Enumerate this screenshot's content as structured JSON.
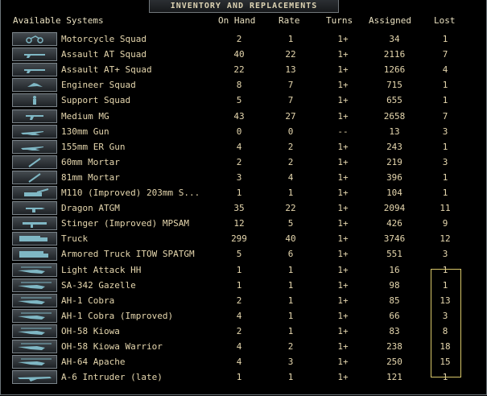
{
  "window": {
    "title": "INVENTORY AND REPLACEMENTS"
  },
  "columns": {
    "name": "Available Systems",
    "on_hand": "On Hand",
    "rate": "Rate",
    "turns": "Turns",
    "assigned": "Assigned",
    "lost": "Lost"
  },
  "rows": [
    {
      "name": "Motorcycle Squad",
      "on_hand": "2",
      "rate": "1",
      "turns": "1+",
      "assigned": "34",
      "lost": "1",
      "icon": "motorcycle-icon"
    },
    {
      "name": "Assault AT Squad",
      "on_hand": "40",
      "rate": "22",
      "turns": "1+",
      "assigned": "2116",
      "lost": "7",
      "icon": "rifle-icon"
    },
    {
      "name": "Assault AT+ Squad",
      "on_hand": "22",
      "rate": "13",
      "turns": "1+",
      "assigned": "1266",
      "lost": "4",
      "icon": "rifle-icon"
    },
    {
      "name": "Engineer Squad",
      "on_hand": "8",
      "rate": "7",
      "turns": "1+",
      "assigned": "715",
      "lost": "1",
      "icon": "engineer-icon"
    },
    {
      "name": "Support Squad",
      "on_hand": "5",
      "rate": "7",
      "turns": "1+",
      "assigned": "655",
      "lost": "1",
      "icon": "soldier-icon"
    },
    {
      "name": "Medium MG",
      "on_hand": "43",
      "rate": "27",
      "turns": "1+",
      "assigned": "2658",
      "lost": "7",
      "icon": "machine-gun-icon"
    },
    {
      "name": "130mm Gun",
      "on_hand": "0",
      "rate": "0",
      "turns": "--",
      "assigned": "13",
      "lost": "3",
      "icon": "artillery-gun-icon"
    },
    {
      "name": "155mm ER Gun",
      "on_hand": "4",
      "rate": "2",
      "turns": "1+",
      "assigned": "243",
      "lost": "1",
      "icon": "artillery-gun-icon"
    },
    {
      "name": "60mm Mortar",
      "on_hand": "2",
      "rate": "2",
      "turns": "1+",
      "assigned": "219",
      "lost": "3",
      "icon": "mortar-icon"
    },
    {
      "name": "81mm Mortar",
      "on_hand": "3",
      "rate": "4",
      "turns": "1+",
      "assigned": "396",
      "lost": "1",
      "icon": "mortar-icon"
    },
    {
      "name": "M110 (Improved) 203mm S...",
      "on_hand": "1",
      "rate": "1",
      "turns": "1+",
      "assigned": "104",
      "lost": "1",
      "icon": "self-propelled-gun-icon"
    },
    {
      "name": "Dragon ATGM",
      "on_hand": "35",
      "rate": "22",
      "turns": "1+",
      "assigned": "2094",
      "lost": "11",
      "icon": "atgm-icon"
    },
    {
      "name": "Stinger (Improved) MPSAM",
      "on_hand": "12",
      "rate": "5",
      "turns": "1+",
      "assigned": "426",
      "lost": "9",
      "icon": "missile-launcher-icon"
    },
    {
      "name": "Truck",
      "on_hand": "299",
      "rate": "40",
      "turns": "1+",
      "assigned": "3746",
      "lost": "12",
      "icon": "truck-icon"
    },
    {
      "name": "Armored Truck ITOW SPATGM",
      "on_hand": "5",
      "rate": "6",
      "turns": "1+",
      "assigned": "551",
      "lost": "3",
      "icon": "armored-truck-icon"
    },
    {
      "name": "Light Attack HH",
      "on_hand": "1",
      "rate": "1",
      "turns": "1+",
      "assigned": "16",
      "lost": "1",
      "icon": "helicopter-icon"
    },
    {
      "name": "SA-342 Gazelle",
      "on_hand": "1",
      "rate": "1",
      "turns": "1+",
      "assigned": "98",
      "lost": "1",
      "icon": "helicopter-icon"
    },
    {
      "name": "AH-1 Cobra",
      "on_hand": "2",
      "rate": "1",
      "turns": "1+",
      "assigned": "85",
      "lost": "13",
      "icon": "helicopter-icon"
    },
    {
      "name": "AH-1 Cobra (Improved)",
      "on_hand": "4",
      "rate": "1",
      "turns": "1+",
      "assigned": "66",
      "lost": "3",
      "icon": "helicopter-icon"
    },
    {
      "name": "OH-58 Kiowa",
      "on_hand": "2",
      "rate": "1",
      "turns": "1+",
      "assigned": "83",
      "lost": "8",
      "icon": "helicopter-icon"
    },
    {
      "name": "OH-58 Kiowa Warrior",
      "on_hand": "4",
      "rate": "2",
      "turns": "1+",
      "assigned": "238",
      "lost": "18",
      "icon": "helicopter-icon"
    },
    {
      "name": "AH-64 Apache",
      "on_hand": "4",
      "rate": "3",
      "turns": "1+",
      "assigned": "250",
      "lost": "15",
      "icon": "helicopter-icon"
    },
    {
      "name": "A-6 Intruder (late)",
      "on_hand": "1",
      "rate": "1",
      "turns": "1+",
      "assigned": "121",
      "lost": "1",
      "icon": "jet-aircraft-icon"
    }
  ],
  "colors": {
    "text": "#e6d7ae",
    "background": "#000000",
    "highlight_box": "#d9c86a",
    "icon": "#7fb7c4"
  }
}
